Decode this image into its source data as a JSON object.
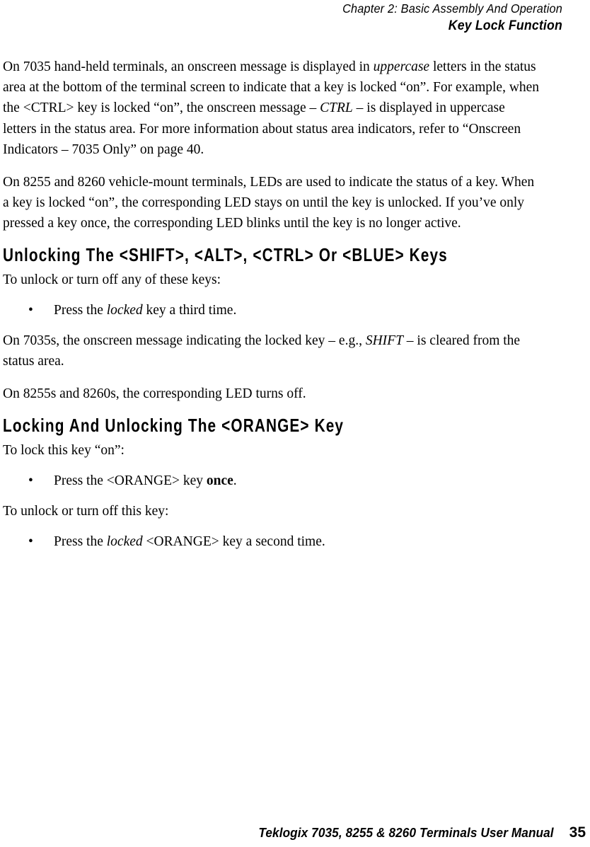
{
  "header": {
    "chapter_line": "Chapter  2:  Basic Assembly And Operation",
    "section_line": "Key Lock Function"
  },
  "body": {
    "para1": {
      "seg1": "On 7035 hand-held terminals, an onscreen message is displayed in ",
      "em1": "uppercase",
      "seg2": " letters in the status area at the bottom of the terminal screen to indicate that a key is locked “on”. For example, when the <CTRL> key is locked “on”, the onscreen message – ",
      "em2": "CTRL",
      "seg3": " – is displayed in uppercase letters in the status area. For more information about status area indicators, refer to “Onscreen Indicators – 7035 Only” on page 40."
    },
    "para2": "On 8255 and 8260 vehicle-mount terminals, LEDs are used to indicate the status of a key. When a key is locked “on”, the corresponding LED stays on until the key is unlocked. If you’ve only pressed a key once, the corresponding LED blinks until the key is no longer active."
  },
  "section1": {
    "heading": "Unlocking The <SHIFT>, <ALT>, <CTRL> Or <BLUE> Keys",
    "lead": "To unlock or turn off any of these keys:",
    "bullet_mark": "•",
    "bullet1": {
      "seg1": "Press the ",
      "em1": "locked",
      "seg2": " key a third time."
    },
    "para_after1": {
      "seg1": "On 7035s, the onscreen message indicating the locked key – e.g., ",
      "em1": "SHIFT",
      "seg2": " – is cleared from the status area."
    },
    "para_after2": "On 8255s and 8260s, the corresponding LED turns off."
  },
  "section2": {
    "heading": "Locking And Unlocking The <ORANGE> Key",
    "lead1": "To lock this key “on”:",
    "bullet_mark": "•",
    "bullet1": {
      "seg1": "Press the <ORANGE> key ",
      "strong1": "once",
      "seg2": "."
    },
    "lead2": "To unlock or turn off this key:",
    "bullet2": {
      "seg1": "Press the ",
      "em1": "locked",
      "seg2": " <ORANGE> key a second time."
    }
  },
  "footer": {
    "manual_title": "Teklogix 7035, 8255 & 8260 Terminals User Manual",
    "page_number": "35"
  }
}
